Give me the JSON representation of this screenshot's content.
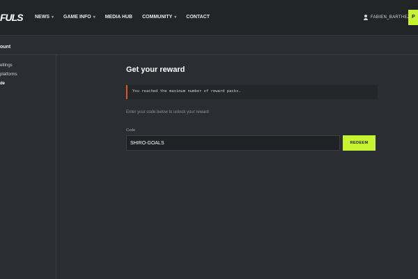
{
  "header": {
    "logo_text": "FULS",
    "nav": [
      {
        "label": "NEWS",
        "has_dropdown": true
      },
      {
        "label": "GAME INFO",
        "has_dropdown": true
      },
      {
        "label": "MEDIA HUB",
        "has_dropdown": false
      },
      {
        "label": "COMMUNITY",
        "has_dropdown": true
      },
      {
        "label": "CONTACT",
        "has_dropdown": false
      }
    ],
    "user": {
      "name": "FABIEN_BARTHEZ",
      "icon": "user-icon"
    },
    "cta_label": "P"
  },
  "sidebar": {
    "title": "ount",
    "items": [
      {
        "label": "ettings"
      },
      {
        "label": "platforms"
      },
      {
        "label": "de"
      }
    ]
  },
  "main": {
    "heading": "Get your reward",
    "alert": "You reached the maximum number of reward packs.",
    "help_text": "Enter your code below to unlock your reward",
    "code_label": "Code",
    "code_value": "SHIRO-GOALS",
    "redeem_label": "REDEEM"
  },
  "colors": {
    "accent": "#c6f432",
    "alert_border": "#e0592c",
    "background": "#2a2d32",
    "topbar": "#222428"
  }
}
